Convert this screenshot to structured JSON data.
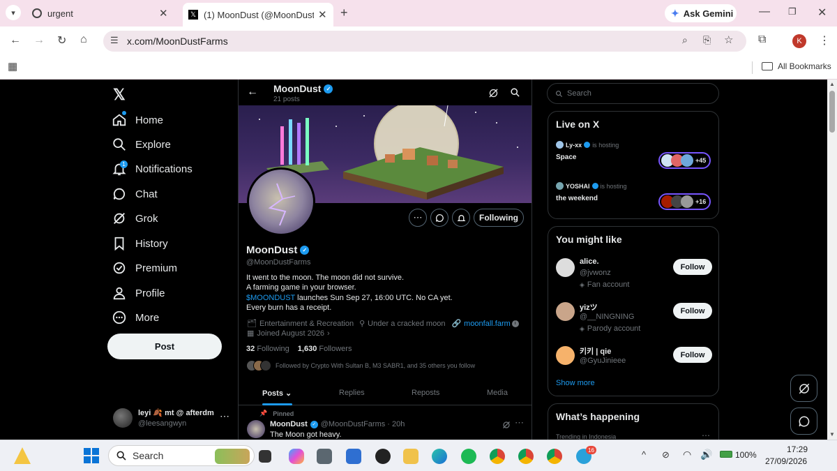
{
  "browser": {
    "tabs": [
      {
        "title": "urgent"
      },
      {
        "title": "(1) MoonDust (@MoonDustFarm"
      }
    ],
    "ask_gemini": "Ask Gemini",
    "url": "x.com/MoonDustFarms",
    "profile_initial": "K",
    "all_bookmarks": "All Bookmarks"
  },
  "nav": {
    "items": [
      {
        "label": "Home",
        "icon": "home-icon"
      },
      {
        "label": "Explore",
        "icon": "search-icon"
      },
      {
        "label": "Notifications",
        "icon": "bell-icon"
      },
      {
        "label": "Chat",
        "icon": "chat-icon"
      },
      {
        "label": "Grok",
        "icon": "grok-icon"
      },
      {
        "label": "History",
        "icon": "bookmark-icon"
      },
      {
        "label": "Premium",
        "icon": "verified-icon"
      },
      {
        "label": "Profile",
        "icon": "person-icon"
      },
      {
        "label": "More",
        "icon": "more-circle-icon"
      }
    ],
    "notification_badge": "1",
    "post_label": "Post",
    "account": {
      "name": "leyi 🍂 mt @ afterdm",
      "handle": "@leesangwyn"
    }
  },
  "profile": {
    "header_name": "MoonDust",
    "header_posts": "21 posts",
    "name": "MoonDust",
    "handle": "@MoonDustFarms",
    "bio_line1": "It went to the moon. The moon did not survive.",
    "bio_line2": "A farming game in your browser.",
    "bio_cashtag": "$MOONDUST",
    "bio_line3_rest": " launches Sun Sep 27, 16:00 UTC. No CA yet.",
    "bio_line4": "Every burn has a receipt.",
    "category": "Entertainment & Recreation",
    "location": "Under a cracked moon",
    "website": "moonfall.farm",
    "joined": "Joined August 2026",
    "following_count": "32",
    "following_label": "Following",
    "followers_count": "1,630",
    "followers_label": "Followers",
    "followed_by": "Followed by Crypto With Sultan B, M3 SABR1, and 35 others you follow",
    "following_btn": "Following",
    "tabs": [
      "Posts",
      "Replies",
      "Reposts",
      "Media"
    ],
    "pinned_label": "Pinned",
    "post_name": "MoonDust",
    "post_meta": "@MoonDustFarms · 20h",
    "post_text": "The Moon got heavy."
  },
  "sidebar": {
    "search_placeholder": "Search",
    "live_title": "Live on X",
    "live": [
      {
        "host": "Ly-xx",
        "status": "is hosting",
        "title": "Space",
        "count": "+45"
      },
      {
        "host": "YOSHAI",
        "status": "is hosting",
        "title": "the weekend",
        "count": "+16"
      }
    ],
    "might_like_title": "You might like",
    "suggestions": [
      {
        "name": "alice.",
        "handle": "@jvwonz",
        "tag": "Fan account",
        "button": "Follow"
      },
      {
        "name": "yizツ",
        "handle": "@__NINGNING",
        "tag": "Parody account",
        "button": "Follow"
      },
      {
        "name": "키키 | qie",
        "handle": "@GyuJinieee",
        "tag": "",
        "button": "Follow"
      }
    ],
    "show_more": "Show more",
    "happening_title": "What’s happening",
    "trending_label": "Trending in Indonesia"
  },
  "taskbar": {
    "search_label": "Search",
    "telegram_badge": "16",
    "battery": "100%",
    "time": "17:29",
    "date": "27/09/2026"
  },
  "colors": {
    "accent": "#1d9bf0",
    "chrome_tab_bg": "#f6e1ec",
    "page_bg": "#000000",
    "border": "#2f3336"
  }
}
